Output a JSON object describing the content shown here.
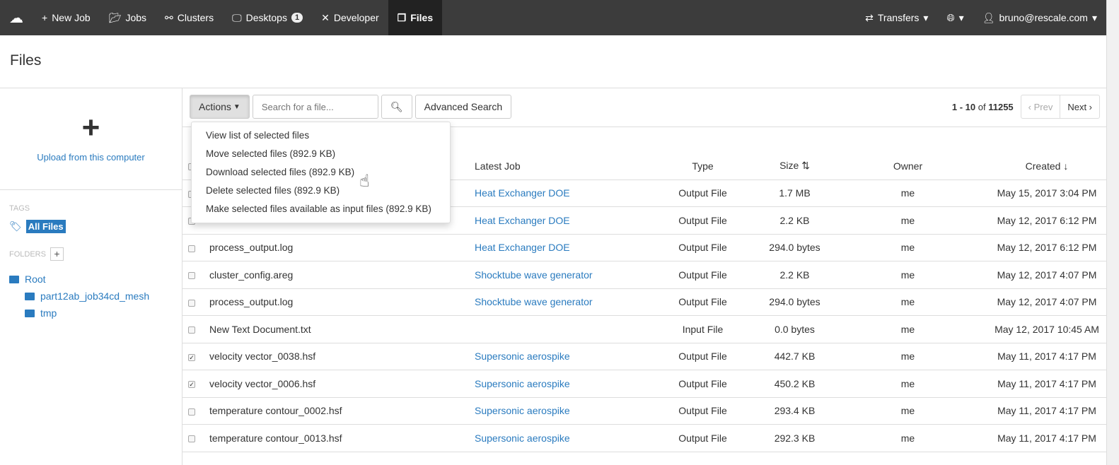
{
  "nav": {
    "items": [
      {
        "label": "New Job",
        "icon": "plus-icon"
      },
      {
        "label": "Jobs",
        "icon": "folder-icon"
      },
      {
        "label": "Clusters",
        "icon": "sitemap-icon"
      },
      {
        "label": "Desktops",
        "icon": "monitor-icon",
        "badge": "1"
      },
      {
        "label": "Developer",
        "icon": "tools-icon"
      },
      {
        "label": "Files",
        "icon": "files-icon",
        "active": true
      }
    ],
    "transfers": "Transfers",
    "user": "bruno@rescale.com"
  },
  "page": {
    "title": "Files"
  },
  "sidebar": {
    "upload": "Upload from this computer",
    "tags_label": "TAGS",
    "all_files": "All Files",
    "folders_label": "FOLDERS",
    "folders": [
      "Root",
      "part12ab_job34cd_mesh",
      "tmp"
    ]
  },
  "toolbar": {
    "actions": "Actions",
    "search_placeholder": "Search for a file...",
    "advanced": "Advanced Search"
  },
  "pager": {
    "range": "1 - 10",
    "of": "of",
    "total": "11255",
    "prev": "‹ Prev",
    "next": "Next ›"
  },
  "dropdown": [
    "View list of selected files",
    "Move selected files (892.9 KB)",
    "Download selected files (892.9 KB)",
    "Delete selected files (892.9 KB)",
    "Make selected files available as input files (892.9 KB)"
  ],
  "table": {
    "headers": [
      "Latest Job",
      "Type",
      "Size",
      "Owner",
      "Created"
    ],
    "rows": [
      {
        "checked": false,
        "name": "",
        "job": "Heat Exchanger DOE",
        "type": "Output File",
        "size": "1.7 MB",
        "owner": "me",
        "created": "May 15, 2017 3:04 PM"
      },
      {
        "checked": false,
        "name": "",
        "job": "Heat Exchanger DOE",
        "type": "Output File",
        "size": "2.2 KB",
        "owner": "me",
        "created": "May 12, 2017 6:12 PM"
      },
      {
        "checked": false,
        "name": "process_output.log",
        "job": "Heat Exchanger DOE",
        "type": "Output File",
        "size": "294.0 bytes",
        "owner": "me",
        "created": "May 12, 2017 6:12 PM"
      },
      {
        "checked": false,
        "name": "cluster_config.areg",
        "job": "Shocktube wave generator",
        "type": "Output File",
        "size": "2.2 KB",
        "owner": "me",
        "created": "May 12, 2017 4:07 PM"
      },
      {
        "checked": false,
        "name": "process_output.log",
        "job": "Shocktube wave generator",
        "type": "Output File",
        "size": "294.0 bytes",
        "owner": "me",
        "created": "May 12, 2017 4:07 PM"
      },
      {
        "checked": false,
        "name": "New Text Document.txt",
        "job": "",
        "type": "Input File",
        "size": "0.0 bytes",
        "owner": "me",
        "created": "May 12, 2017 10:45 AM"
      },
      {
        "checked": true,
        "name": "velocity vector_0038.hsf",
        "job": "Supersonic aerospike",
        "type": "Output File",
        "size": "442.7 KB",
        "owner": "me",
        "created": "May 11, 2017 4:17 PM"
      },
      {
        "checked": true,
        "name": "velocity vector_0006.hsf",
        "job": "Supersonic aerospike",
        "type": "Output File",
        "size": "450.2 KB",
        "owner": "me",
        "created": "May 11, 2017 4:17 PM"
      },
      {
        "checked": false,
        "name": "temperature contour_0002.hsf",
        "job": "Supersonic aerospike",
        "type": "Output File",
        "size": "293.4 KB",
        "owner": "me",
        "created": "May 11, 2017 4:17 PM"
      },
      {
        "checked": false,
        "name": "temperature contour_0013.hsf",
        "job": "Supersonic aerospike",
        "type": "Output File",
        "size": "292.3 KB",
        "owner": "me",
        "created": "May 11, 2017 4:17 PM"
      }
    ]
  }
}
